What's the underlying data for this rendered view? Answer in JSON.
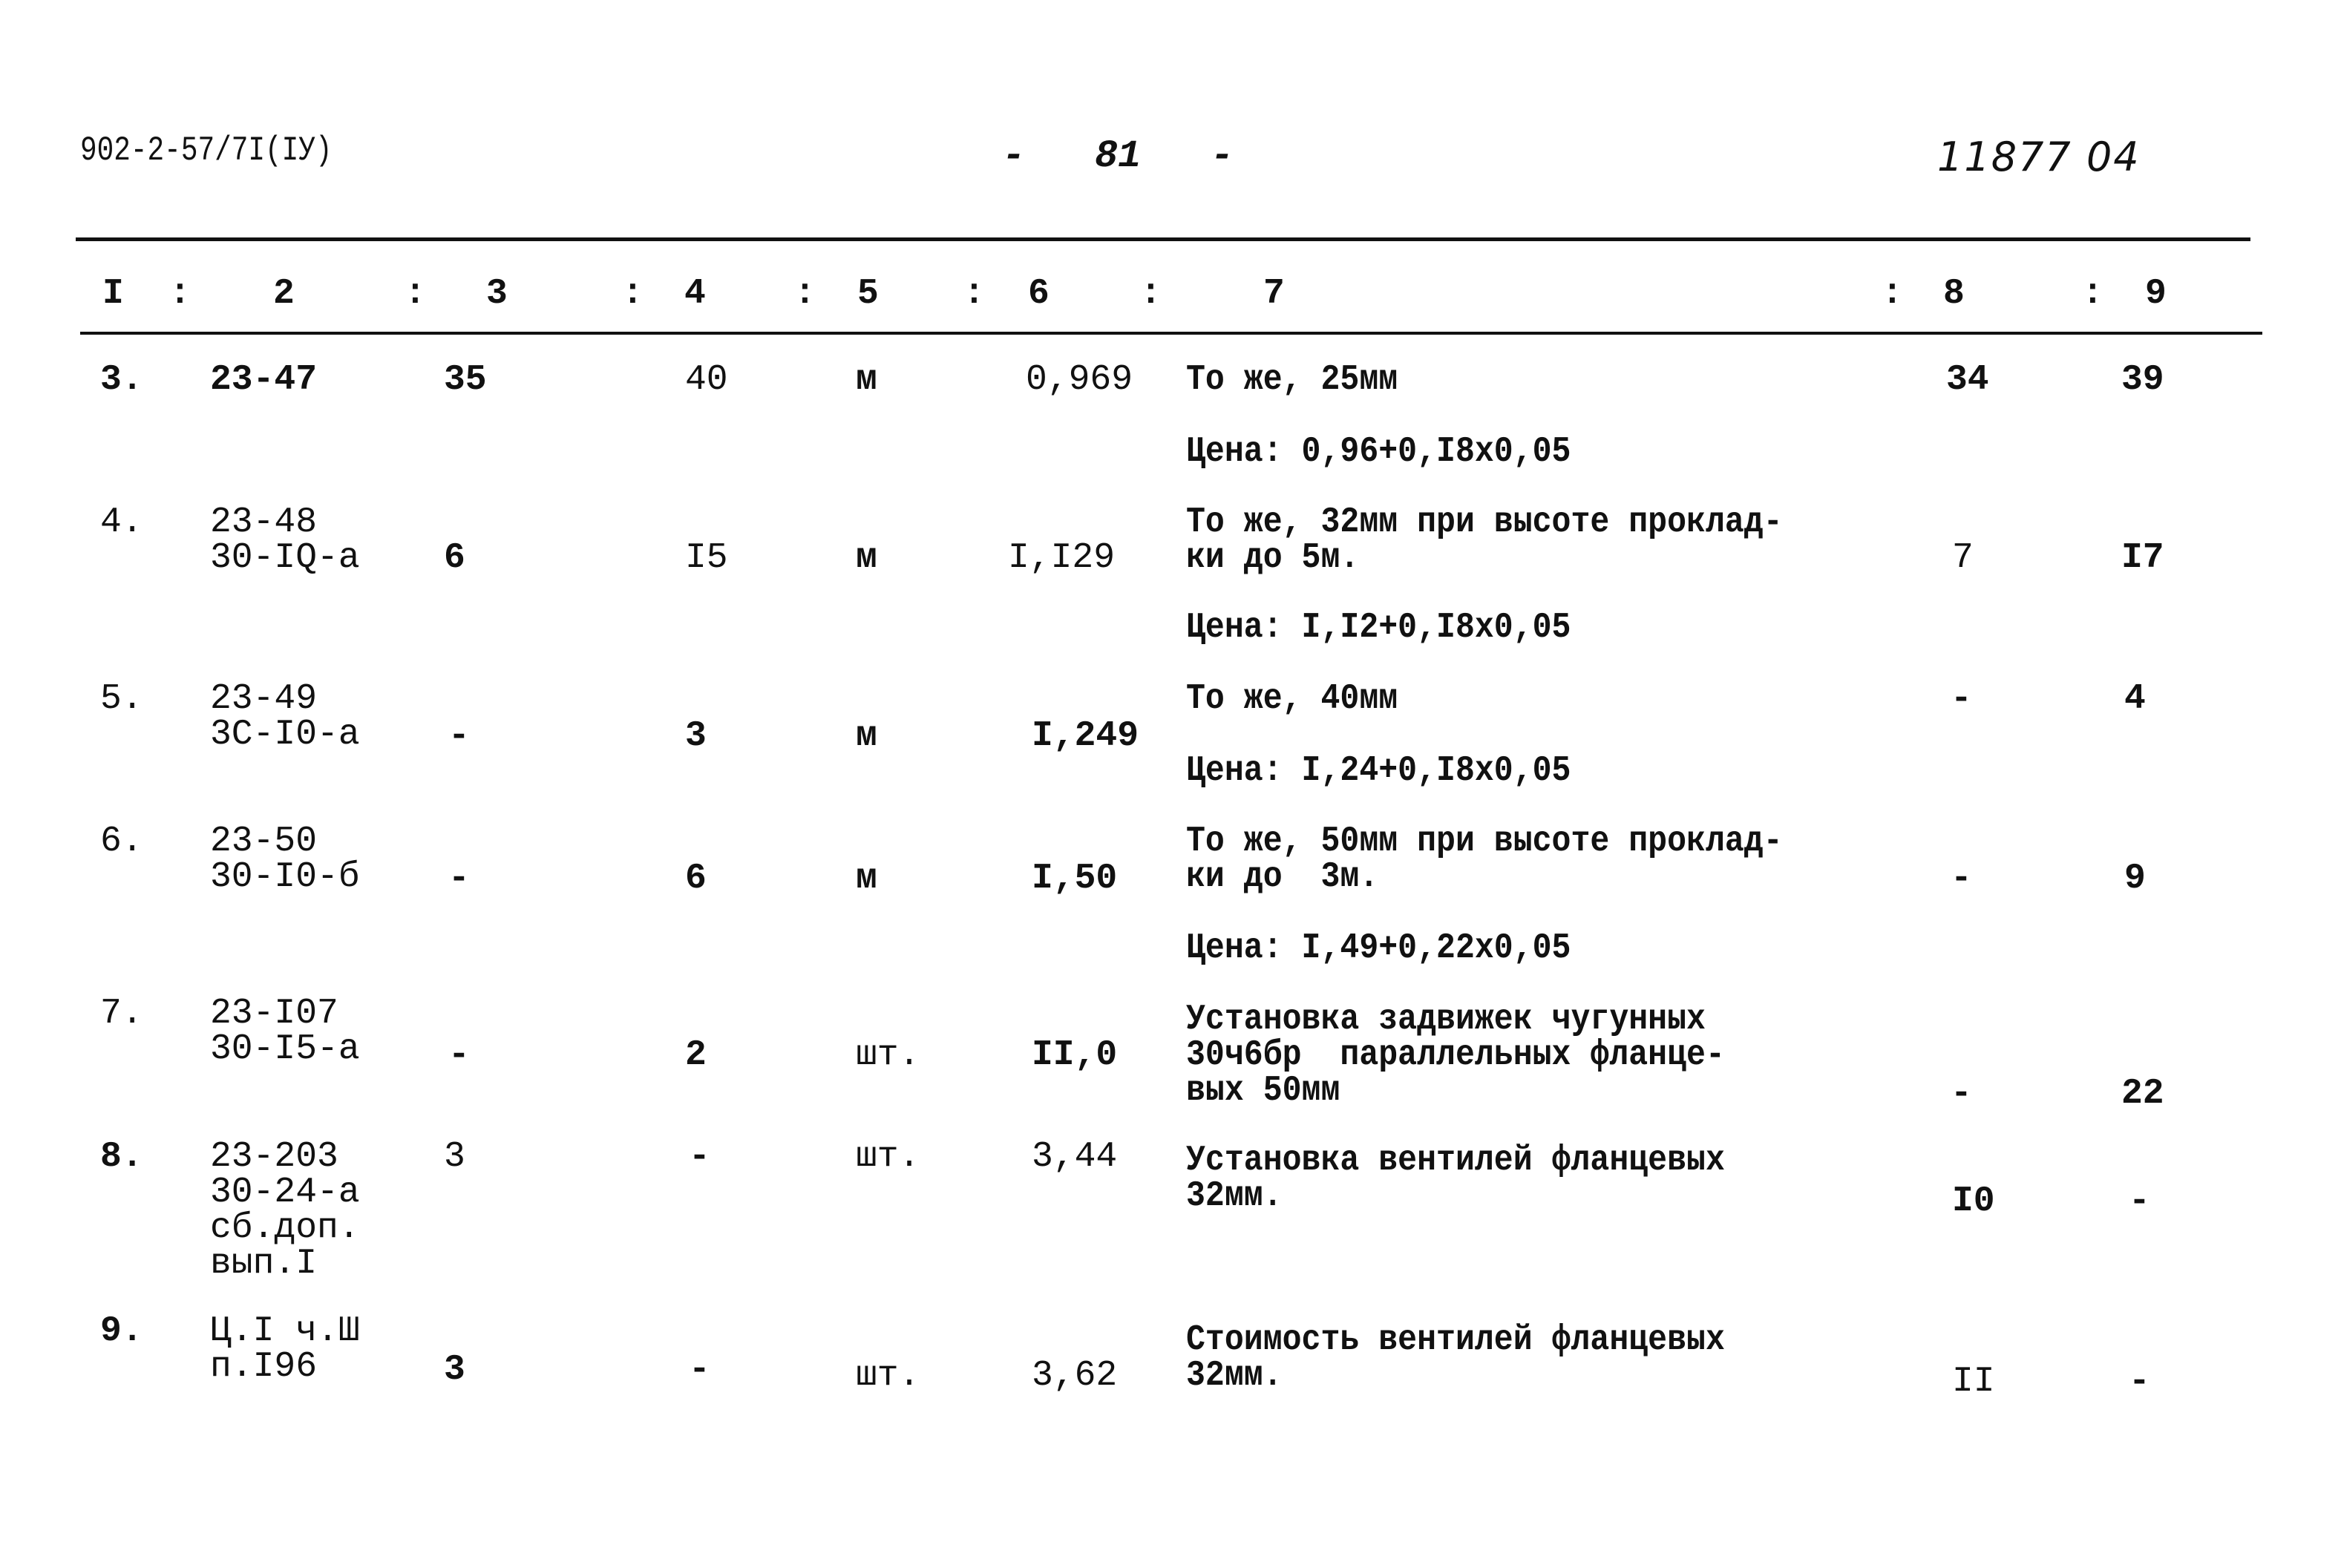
{
  "header": {
    "doc_code": "902-2-57/7I(IУ)",
    "page_number": "-   81   -",
    "inventory_number": "11877 04"
  },
  "table": {
    "column_headers": [
      "I",
      ":",
      "2",
      ":",
      "3",
      ":",
      "4",
      ":",
      "5",
      ":",
      "6",
      ":",
      "7",
      ":",
      "8",
      ":",
      "9"
    ],
    "columns": {
      "c1": "I",
      "c2": "2",
      "c3": "3",
      "c4": "4",
      "c5": "5",
      "c6": "6",
      "c7": "7",
      "c8": "8",
      "c9": "9"
    },
    "rows": [
      {
        "num": "3.",
        "code": "23-47",
        "col3": "35",
        "col4": "40",
        "unit": "м",
        "price": "0,969",
        "description": "То же, 25мм",
        "price_note": "Цена: 0,96+0,I8x0,05",
        "col8": "34",
        "col9": "39"
      },
      {
        "num": "4.",
        "code": "23-48\n30-IQ-а",
        "col3": "6",
        "col4": "I5",
        "unit": "м",
        "price": "I,I29",
        "description": "То же, 32мм при высоте проклад-\nки до 5м.",
        "price_note": "Цена: I,I2+0,I8x0,05",
        "col8": "7",
        "col9": "I7"
      },
      {
        "num": "5.",
        "code": "23-49\n3С-I0-а",
        "col3": "-",
        "col4": "3",
        "unit": "м",
        "price": "I,249",
        "description": "То же, 40мм",
        "price_note": "Цена: I,24+0,I8x0,05",
        "col8": "-",
        "col9": "4"
      },
      {
        "num": "6.",
        "code": "23-50\n30-I0-б",
        "col3": "-",
        "col4": "6",
        "unit": "м",
        "price": "I,50",
        "description": "То же, 50мм при высоте проклад-\nки до  3м.",
        "price_note": "Цена: I,49+0,22x0,05",
        "col8": "-",
        "col9": "9"
      },
      {
        "num": "7.",
        "code": "23-I07\n30-I5-а",
        "col3": "-",
        "col4": "2",
        "unit": "шт.",
        "price": "II,0",
        "description": "Установка задвижек чугунных\n30ч6бр  параллельных фланце-\nвых 50мм",
        "price_note": "",
        "col8": "-",
        "col9": "22"
      },
      {
        "num": "8.",
        "code": "23-203\n30-24-а\nсб.доп.\nвып.I",
        "col3": "3",
        "col4": "-",
        "unit": "шт.",
        "price": "3,44",
        "description": "Установка вентилей фланцевых\n32мм.",
        "price_note": "",
        "col8": "I0",
        "col9": "-"
      },
      {
        "num": "9.",
        "code": "Ц.I ч.Ш\nп.I96",
        "col3": "3",
        "col4": "-",
        "unit": "шт.",
        "price": "3,62",
        "description": "Стоимость вентилей фланцевых\n32мм.",
        "price_note": "",
        "col8": "II",
        "col9": "-"
      }
    ]
  }
}
